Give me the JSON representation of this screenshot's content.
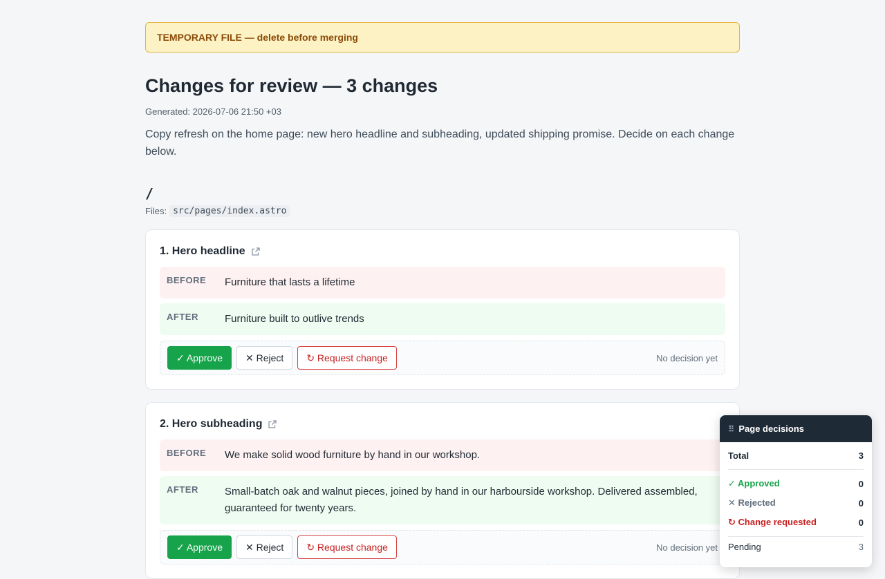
{
  "banner": {
    "text": "TEMPORARY FILE — delete before merging"
  },
  "header": {
    "title": "Changes for review — 3 changes",
    "generated": "Generated: 2026-07-06 21:50 +03",
    "description": "Copy refresh on the home page: new hero headline and subheading, updated shipping promise. Decide on each change below."
  },
  "section": {
    "path": "/",
    "files_label": "Files:",
    "file": "src/pages/index.astro"
  },
  "labels": {
    "before": "BEFORE",
    "after": "AFTER",
    "approve": "✓ Approve",
    "reject": "✕ Reject",
    "request": "↻ Request change"
  },
  "changes": [
    {
      "title": "1. Hero headline",
      "before": "Furniture that lasts a lifetime",
      "after": "Furniture built to outlive trends",
      "status": "No decision yet"
    },
    {
      "title": "2. Hero subheading",
      "before": "We make solid wood furniture by hand in our workshop.",
      "after": "Small-batch oak and walnut pieces, joined by hand in our harbourside workshop. Delivered assembled, guaranteed for twenty years.",
      "status": "No decision yet"
    }
  ],
  "panel": {
    "title": "Page decisions",
    "total_label": "Total",
    "total": "3",
    "approved_label": "✓ Approved",
    "approved": "0",
    "rejected_label": "✕ Rejected",
    "rejected": "0",
    "requested_label": "↻ Change requested",
    "requested": "0",
    "pending_label": "Pending",
    "pending": "3"
  },
  "colors": {
    "approve": "#16a34a",
    "request": "#c81e1e",
    "banner_bg": "#fdf2c4",
    "panel_head": "#1f2a37"
  }
}
